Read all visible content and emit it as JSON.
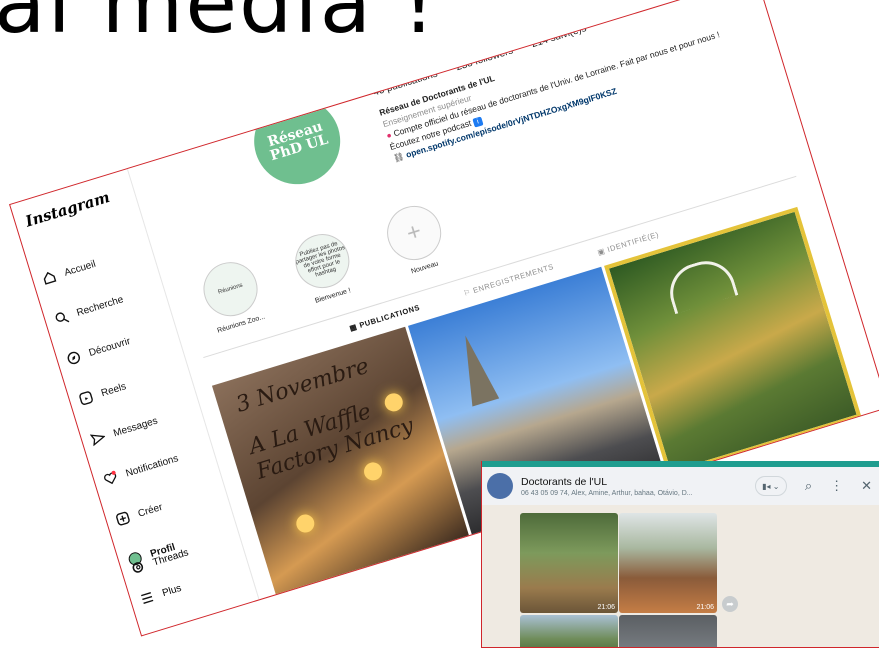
{
  "slide": {
    "title": "al media !"
  },
  "instagram": {
    "logo": "Instagram",
    "nav": [
      {
        "label": "Accueil",
        "icon": "home-icon"
      },
      {
        "label": "Recherche",
        "icon": "search-icon"
      },
      {
        "label": "Découvrir",
        "icon": "compass-icon"
      },
      {
        "label": "Reels",
        "icon": "reels-icon"
      },
      {
        "label": "Messages",
        "icon": "send-icon"
      },
      {
        "label": "Notifications",
        "icon": "heart-icon"
      },
      {
        "label": "Créer",
        "icon": "plus-square-icon"
      },
      {
        "label": "Profil",
        "icon": "profile-avatar"
      }
    ],
    "bottom_nav": [
      {
        "label": "Threads",
        "icon": "threads-icon"
      },
      {
        "label": "Plus",
        "icon": "menu-icon"
      }
    ],
    "profile": {
      "avatar_line1": "Réseau",
      "avatar_line2": "PhD UL",
      "stats": {
        "publications": "46 publications",
        "followers": "238 followers",
        "following": "214 suivi(e)s"
      },
      "name": "Réseau de Doctorants de l'UL",
      "category": "Enseignement supérieur",
      "bio_line1": "Compte officiel du réseau de doctorants de l'Univ. de Lorraine. Fait par nous et pour nous !",
      "bio_line2": "Écoutez notre podcast",
      "link": "open.spotify.com/episode/0rVjNTDHZOxgXM9gIF0KSZ"
    },
    "highlights": [
      {
        "label": "Réunions Zoo...",
        "inner": "Réunions"
      },
      {
        "label": "Bienvenue !",
        "inner": "Publiez pas de partager les photos de votre forme effort pour le hashtag"
      },
      {
        "label": "Nouveau",
        "inner": "+"
      }
    ],
    "tabs": [
      {
        "label": "PUBLICATIONS",
        "icon": "grid-icon",
        "active": true
      },
      {
        "label": "ENREGISTREMENTS",
        "icon": "bookmark-icon",
        "active": false
      },
      {
        "label": "IDENTIFIÉ(E)",
        "icon": "tag-icon",
        "active": false
      }
    ],
    "posts": [
      {
        "text_lines": [
          "3 Novembre",
          "A La Waffle",
          "Factory Nancy"
        ]
      },
      {
        "text_lines": []
      },
      {
        "text_lines": []
      }
    ]
  },
  "whatsapp": {
    "chat_title": "Doctorants de l'UL",
    "participants": "06 43 05 09 74, Alex, Amine, Arthur, bahaa, Otávio, D...",
    "photos": [
      {
        "time": "21:06"
      },
      {
        "time": "21:06"
      },
      {
        "time": ""
      },
      {
        "time": ""
      }
    ],
    "icons": {
      "video": "video-call-icon",
      "search": "search-icon",
      "menu": "more-vertical-icon",
      "close": "close-icon",
      "forward": "forward-icon"
    },
    "colors": {
      "accent": "#1f9d8f",
      "background": "#efeae2"
    }
  }
}
